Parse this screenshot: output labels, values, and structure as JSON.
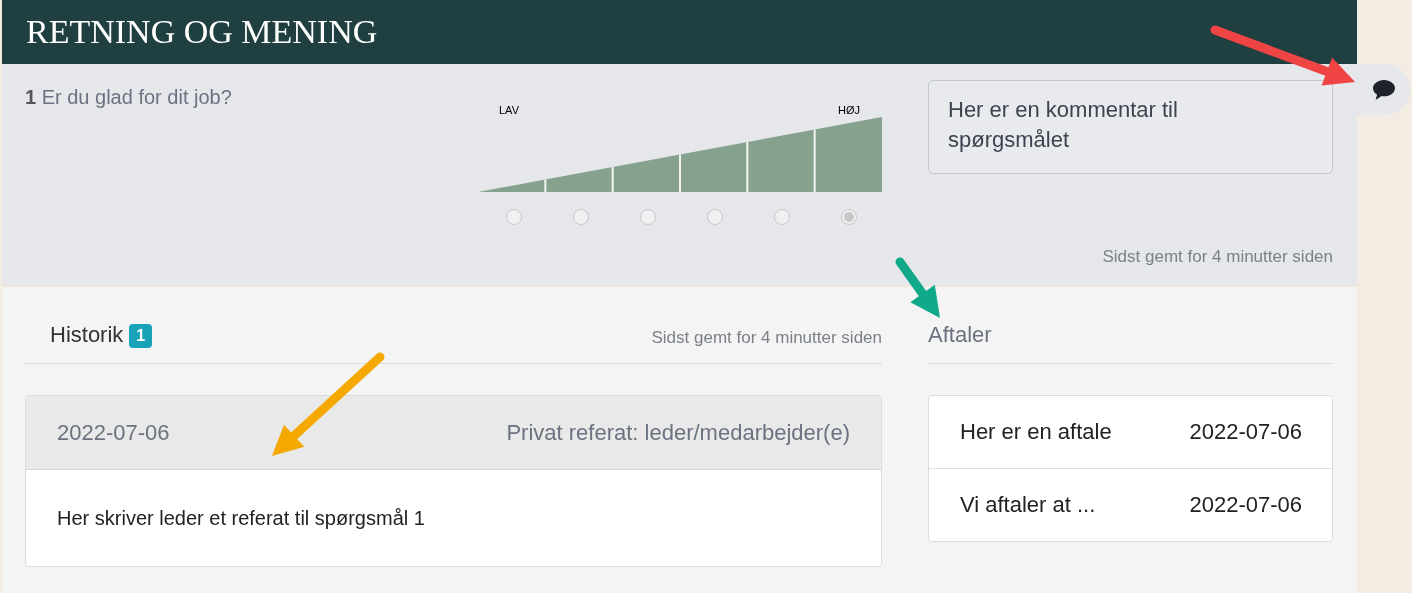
{
  "header": {
    "title": "RETNING OG MENING"
  },
  "question": {
    "number": "1",
    "text": "Er du glad for dit job?",
    "scale": {
      "low_label": "LAV",
      "high_label": "HØJ",
      "options": [
        {
          "selected": false
        },
        {
          "selected": false
        },
        {
          "selected": false
        },
        {
          "selected": false
        },
        {
          "selected": false
        },
        {
          "selected": true
        }
      ]
    },
    "comment": {
      "value": "Her er en kommentar til spørgsmålet"
    },
    "saved_status": "Sidst gemt for 4 minutter siden"
  },
  "history": {
    "title": "Historik",
    "badge": "1",
    "saved_status": "Sidst gemt for 4 minutter siden",
    "entries": [
      {
        "date": "2022-07-06",
        "type": "Privat referat: leder/medarbejder(e)",
        "text": "Her skriver leder et referat til spørgsmål 1"
      }
    ]
  },
  "agreements": {
    "title": "Aftaler",
    "rows": [
      {
        "text": "Her er en aftale",
        "date": "2022-07-06"
      },
      {
        "text": "Vi aftaler at ...",
        "date": "2022-07-06"
      }
    ]
  },
  "annotation_arrows": [
    {
      "color": "#ef4444"
    },
    {
      "color": "#10a98a"
    },
    {
      "color": "#f5a800"
    }
  ]
}
